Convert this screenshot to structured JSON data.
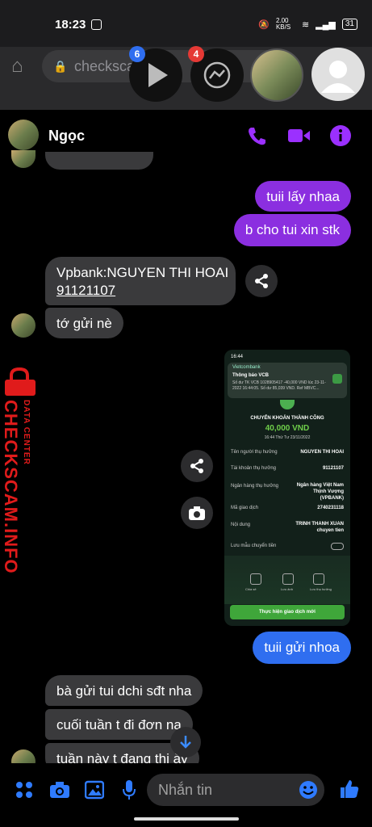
{
  "status_bar": {
    "time": "18:23",
    "net_speed": "2.00 KB/S",
    "battery": "31"
  },
  "browser": {
    "url_text": "checksca"
  },
  "chat_heads": [
    {
      "name": "video-app",
      "badge": "6"
    },
    {
      "name": "messenger",
      "badge": "4"
    }
  ],
  "header": {
    "contact_name": "Ngọc"
  },
  "messages": {
    "out1": "tuii lấy nhaa",
    "out2": "b cho tui xin stk",
    "in1_line1": "Vpbank:NGUYEN THI HOAI",
    "in1_line2": "91121107",
    "in2": "tớ gửi nè",
    "out3": "tuii gửi nhoa",
    "in3": "bà gửi tui dchi sđt nha",
    "in4": "cuối tuần t đi đơn na",
    "in5": "tuần này t đang thi ày"
  },
  "receipt": {
    "status_time": "16:44",
    "bank": "Vietcombank",
    "notice": "Thông báo VCB",
    "notice_text": "Số dư TK VCB 1028905417 -40,000 VND lúc 23-11-2022 16:44:05. Số dư 85,039 VND. Ref MBVC...",
    "title": "CHUYỂN KHOẢN THÀNH CÔNG",
    "amount": "40,000 VND",
    "datetime": "16:44 Thứ Tư 23/11/2022",
    "rows": [
      {
        "label": "Tên người thụ hưởng",
        "value": "NGUYEN THI HOAI"
      },
      {
        "label": "Tài khoản thụ hưởng",
        "value": "91121107"
      },
      {
        "label": "Ngân hàng thụ hưởng",
        "value": "Ngân hàng Việt Nam Thịnh Vượng (VPBANK)"
      },
      {
        "label": "Mã giao dịch",
        "value": "2740231118"
      },
      {
        "label": "Nội dung",
        "value": "TRINH THANH XUAN chuyen tien"
      },
      {
        "label": "Lưu mẫu chuyển tiền",
        "value": ""
      }
    ],
    "actions": [
      "Chia sẻ",
      "Lưu ảnh",
      "Lưu thụ hưởng"
    ],
    "cta": "Thực hiện giao dịch mới"
  },
  "watermark": {
    "brand": "CHECKSCAM.INFO",
    "sub": "DATA CENTER"
  },
  "composer": {
    "placeholder": "Nhắn tin"
  },
  "colors": {
    "accent": "#9b30ff",
    "out_bubble": "#8b2fe0",
    "blue_bubble": "#2f6ef0",
    "in_bubble": "#3a3a3c",
    "watermark": "#e01b1b"
  }
}
